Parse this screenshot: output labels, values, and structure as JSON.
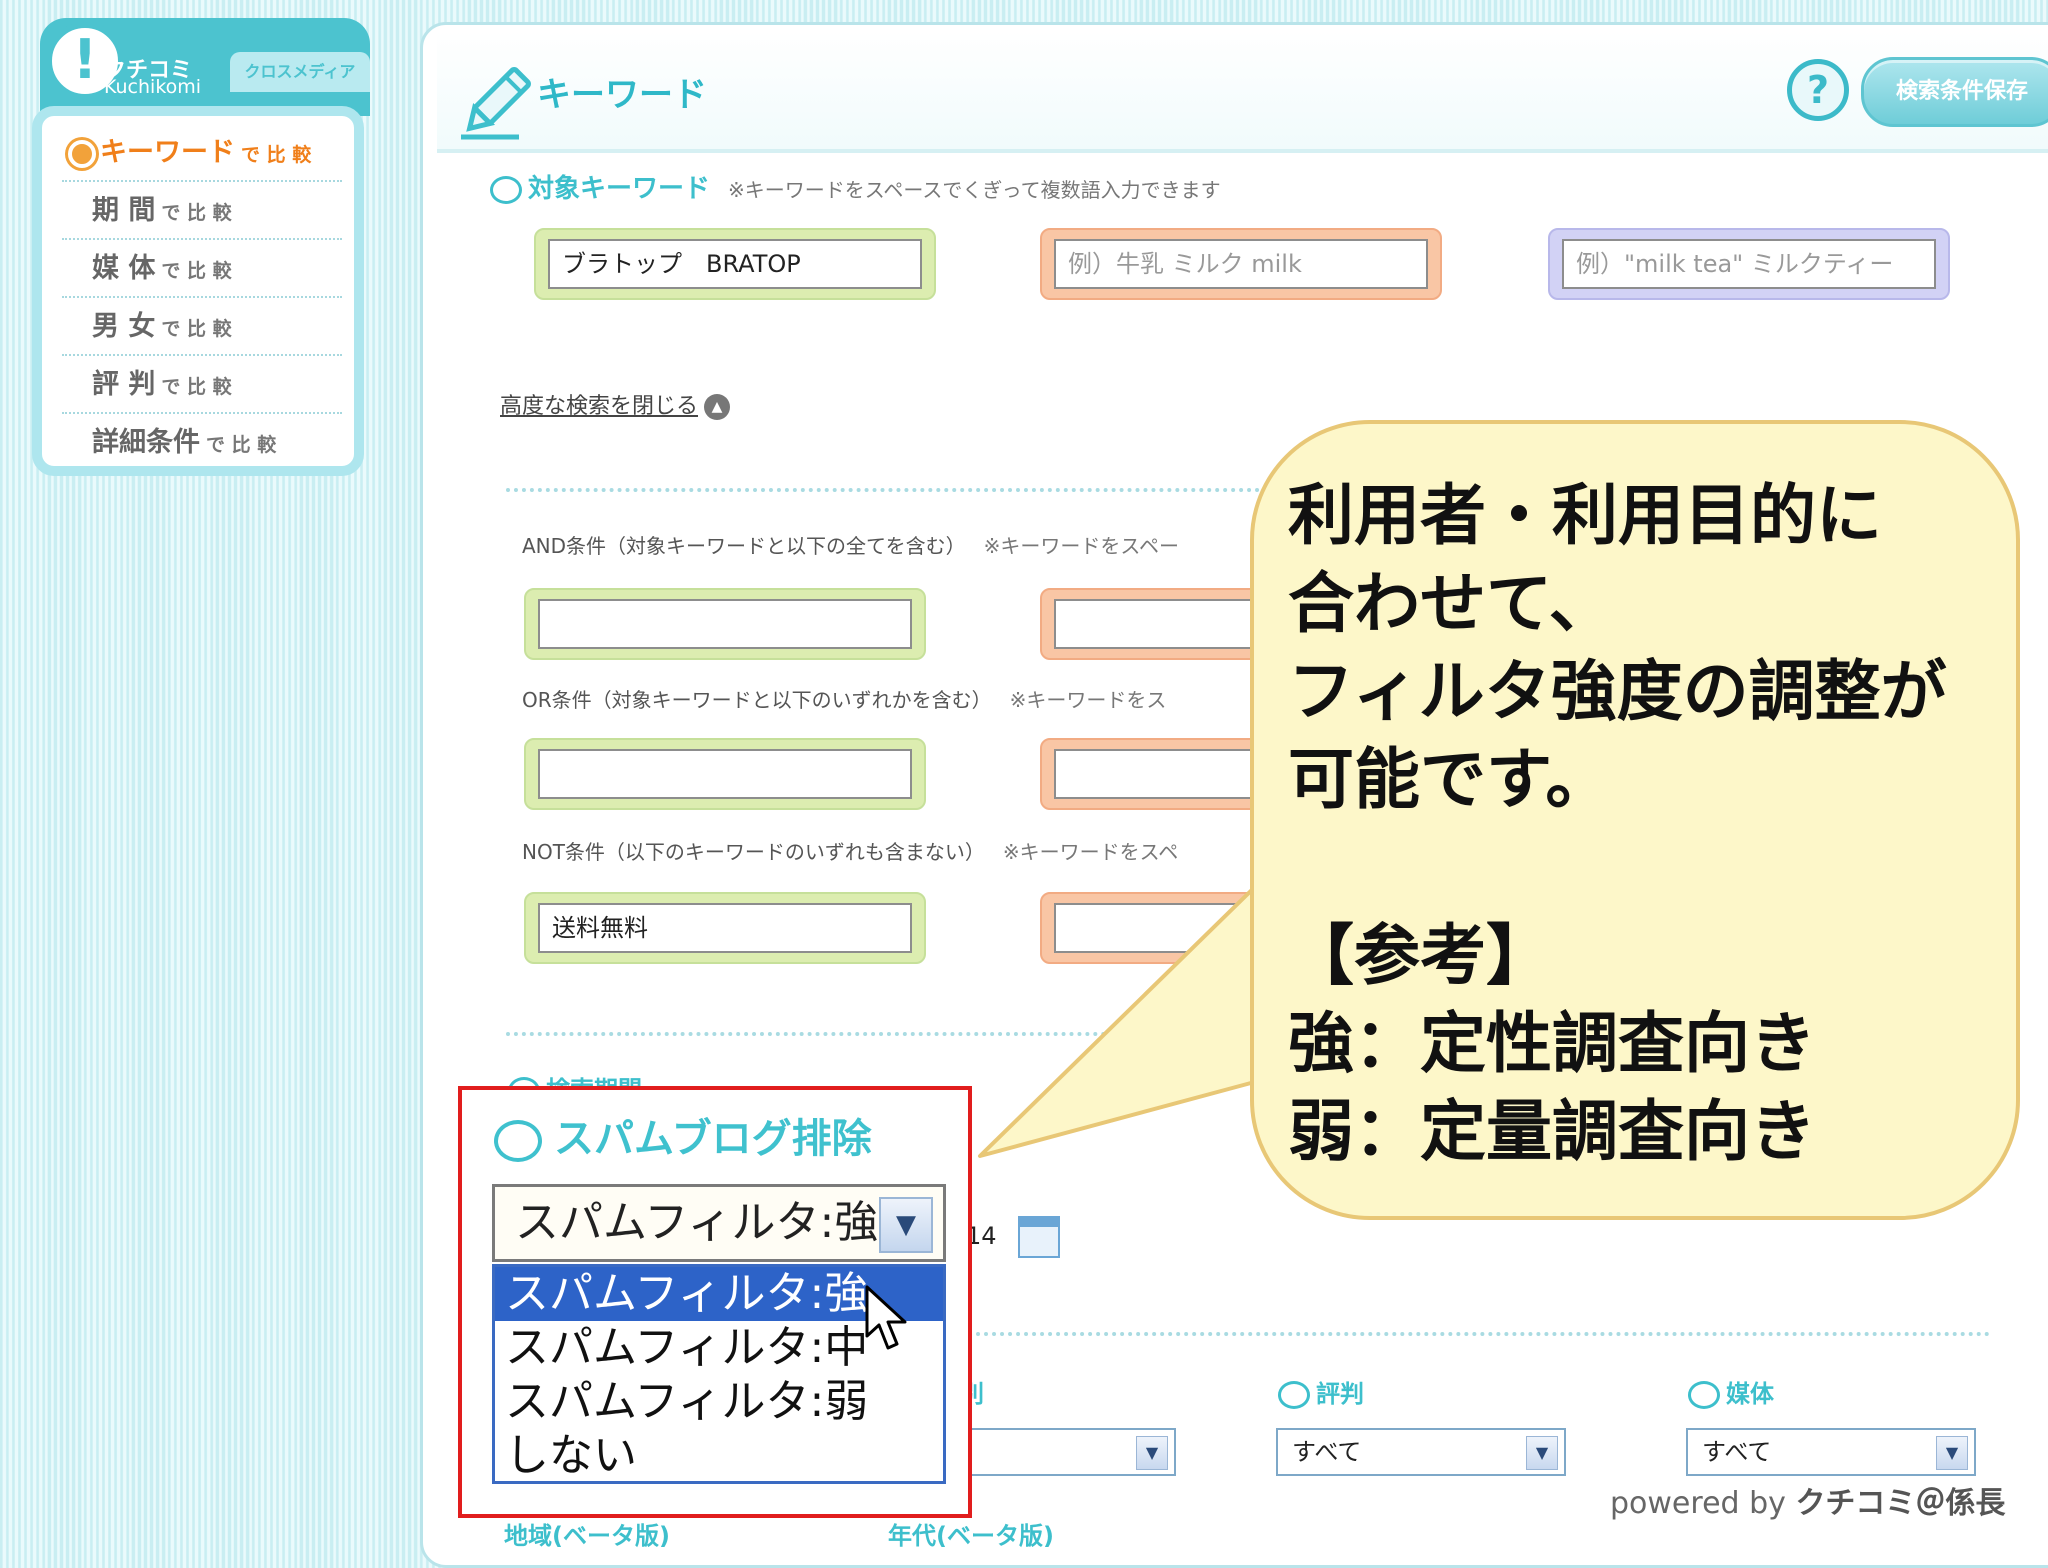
{
  "nav": {
    "logo_jp": "クチコミ",
    "logo_en": "Kuchikomi",
    "logo_tab": "クロスメディア",
    "items": [
      {
        "main": "キーワード",
        "suffix": "で 比 較"
      },
      {
        "main": "期 間",
        "suffix": "で 比 較"
      },
      {
        "main": "媒 体",
        "suffix": "で 比 較"
      },
      {
        "main": "男 女",
        "suffix": "で 比 較"
      },
      {
        "main": "評 判",
        "suffix": "で 比 較"
      },
      {
        "main": "詳細条件",
        "suffix": "で 比 較"
      }
    ]
  },
  "header": {
    "title": "キーワード",
    "help": "?",
    "save_button": "検索条件保存"
  },
  "target_keyword": {
    "label": "対象キーワード",
    "note": "※キーワードをスペースでくぎって複数語入力できます",
    "inputs": [
      "ブラトップ　BRATOP",
      "例）牛乳 ミルク milk",
      "例）\"milk tea\" ミルクティー"
    ]
  },
  "advanced_link": "高度な検索を閉じる",
  "conditions": {
    "and_label": "AND条件（対象キーワードと以下の全てを含む）",
    "and_note": "※キーワードをスペー",
    "or_label": "OR条件（対象キーワードと以下のいずれかを含む）",
    "or_note": "※キーワードをス",
    "not_label": "NOT条件（以下のキーワードのいずれも含まない）",
    "not_note": "※キーワードをスペ",
    "not_value": "送料無料"
  },
  "period_partial": "検索期間",
  "date_partial": "14",
  "filters": {
    "gender_partial": "別",
    "reputation_label": "評判",
    "reputation_value": "すべて",
    "media_label": "媒体",
    "media_value": "すべて"
  },
  "bottom_partial": [
    "地域(ベータ版)",
    "年代(ベータ版)"
  ],
  "spam": {
    "title": "スパムブログ排除",
    "selected": "スパムフィルタ:強",
    "options": [
      "スパムフィルタ:強",
      "スパムフィルタ:中",
      "スパムフィルタ:弱",
      "しない"
    ]
  },
  "callout": {
    "lines": [
      "利用者・利用目的に",
      "合わせて、",
      "フィルタ強度の調整が",
      "可能です。",
      "",
      "【参考】",
      "強：定性調査向き",
      "弱：定量調査向き"
    ]
  },
  "footer": {
    "prefix": "powered by ",
    "brand": "クチコミ＠係長"
  },
  "colors": {
    "accent": "#3dbfcc",
    "highlight_red": "#e11d1d",
    "selected_blue": "#2d63c8",
    "callout_bg": "#fdf7c9"
  }
}
